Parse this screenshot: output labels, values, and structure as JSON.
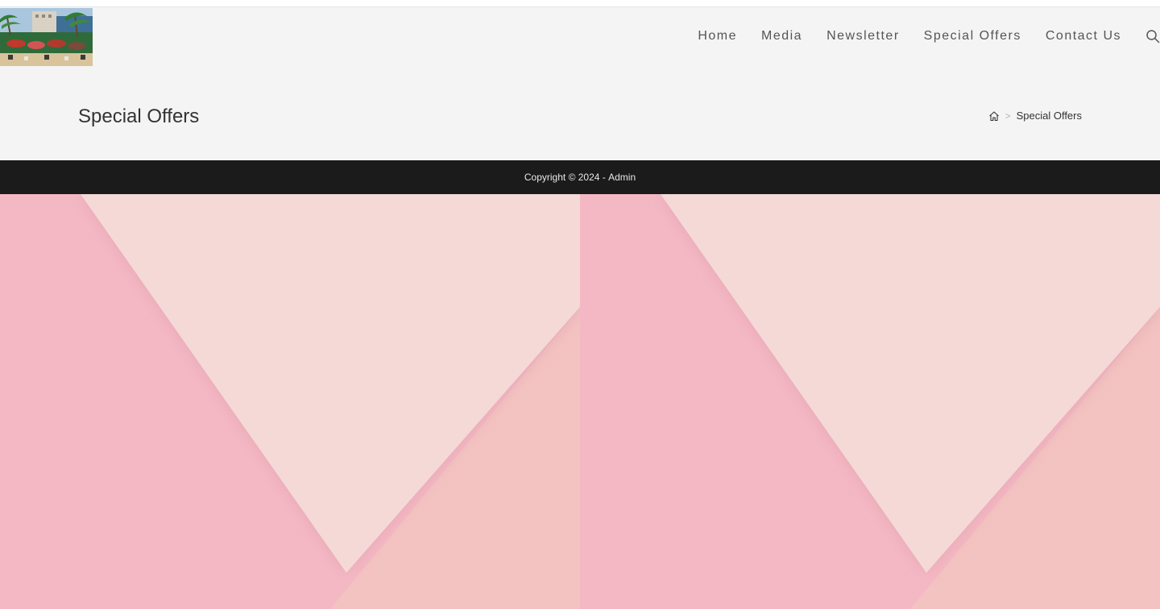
{
  "header": {
    "logo_alt": "Beach resort logo",
    "nav": [
      {
        "label": "Home"
      },
      {
        "label": "Media"
      },
      {
        "label": "Newsletter"
      },
      {
        "label": "Special Offers"
      },
      {
        "label": "Contact Us"
      }
    ],
    "search_icon": "search-icon"
  },
  "title_bar": {
    "title": "Special Offers",
    "breadcrumb": {
      "home_icon": "home-icon",
      "separator": ">",
      "current": "Special Offers"
    }
  },
  "footer": {
    "copyright_prefix": "Copyright © 2024 - ",
    "author": "Admin"
  },
  "background": {
    "colors": {
      "pink_left": "#f4b8c4",
      "pink_light": "#f4d9d7",
      "pink_right": "#f3c3c1",
      "shadow": "#d99aa4"
    }
  },
  "theme": {
    "header_bg": "#f4f4f4",
    "footer_bg": "#1b1b1b",
    "nav_text": "#555555",
    "title_text": "#333333"
  }
}
